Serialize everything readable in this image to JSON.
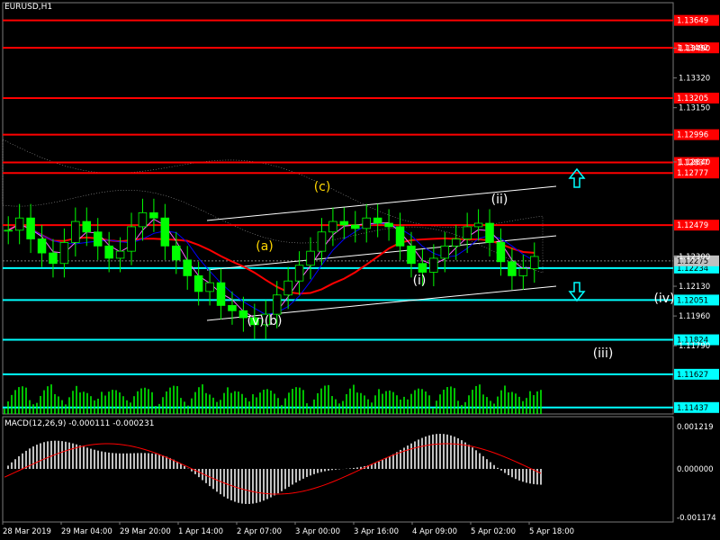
{
  "window": {
    "symbol_title": "EURUSD,H1"
  },
  "macd": {
    "title": "MACD(12,26,9) -0.000111 -0.000231"
  },
  "price_axis": {
    "ticks": [
      "1.13490",
      "1.13320",
      "1.13150",
      "1.12840",
      "1.12300",
      "1.12130",
      "1.11960",
      "1.11790"
    ]
  },
  "levels": {
    "resistance": [
      "1.13649",
      "1.13492",
      "1.13205",
      "1.12996",
      "1.12837",
      "1.12777",
      "1.12479"
    ],
    "support": [
      "1.12234",
      "1.12051",
      "1.11824",
      "1.11627",
      "1.11437"
    ],
    "current_price": "1.12275"
  },
  "macd_axis": [
    "0.001219",
    "0.000000",
    "-0.001174"
  ],
  "time_axis": [
    "28 Mar 2019",
    "29 Mar 04:00",
    "29 Mar 20:00",
    "1 Apr 14:00",
    "2 Apr 07:00",
    "3 Apr 00:00",
    "3 Apr 16:00",
    "4 Apr 09:00",
    "5 Apr 02:00",
    "5 Apr 18:00"
  ],
  "wave_labels": [
    "(c)",
    "(a)",
    "(v)(b)",
    "(ii)",
    "(i)",
    "(iv)",
    "(iii)"
  ],
  "colors": {
    "background": "#000000",
    "grid": "#7a7a7a",
    "resistance": "#ff0000",
    "support": "#00ffff",
    "candle": "#00ff00",
    "histogram": "#c0c0c0",
    "signal": "#ff0000",
    "ichimoku_cloud": "#ffffff",
    "wave_yellow": "#ffd700",
    "wave_white": "#ffffff",
    "arrow_up": "#00ffff",
    "arrow_down": "#00ffff"
  },
  "icons": [
    "arrow-up-icon",
    "arrow-down-icon"
  ],
  "chart_data": {
    "type": "line",
    "title": "EURUSD,H1",
    "xlabel": "",
    "ylabel": "",
    "ylim": [
      1.114,
      1.1375
    ],
    "series": [
      {
        "values": [
          1.1245,
          1.1252,
          1.124,
          1.1232,
          1.1226,
          1.1238,
          1.125,
          1.1244,
          1.1236,
          1.1229,
          1.1233,
          1.1247,
          1.1255,
          1.1252,
          1.1236,
          1.1228,
          1.1219,
          1.121,
          1.1215,
          1.1202,
          1.1199,
          1.1195,
          1.1191,
          1.1197,
          1.1208,
          1.1216,
          1.1225,
          1.1233,
          1.1244,
          1.125,
          1.1248,
          1.1246,
          1.1252,
          1.1249,
          1.1247,
          1.1236,
          1.1226,
          1.1221,
          1.1229,
          1.1236,
          1.124,
          1.1247,
          1.1249,
          1.1238,
          1.1227,
          1.1219,
          1.1223,
          1.123
        ]
      }
    ]
  }
}
